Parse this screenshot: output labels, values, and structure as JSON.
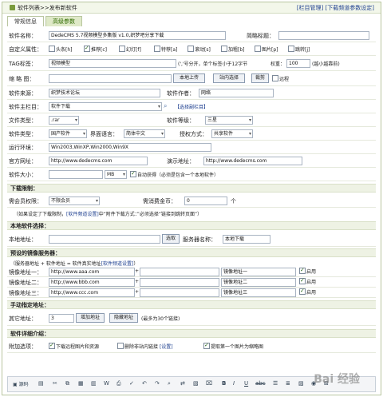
{
  "titlebar": {
    "crumb": "软件列表>>发布新软件",
    "link_manage": "[栏目管理]",
    "link_settings": "[下载频道参数设定]"
  },
  "tabs": [
    "常规信息",
    "高级参数"
  ],
  "form": {
    "software_name_label": "软件名称：",
    "software_name_value": "DedeCMS 5.7视频模型多集版 v1.0,织梦吧分享下载",
    "short_title_label": "简略标题：",
    "custom_attr_label": "自定义属性：",
    "attrs": [
      "头条[h]",
      "推荐[c]",
      "幻灯[f]",
      "特荐[a]",
      "滚动[s]",
      "加粗[b]",
      "图片[p]",
      "跳转[j]"
    ],
    "attrs_checked": [
      false,
      true,
      false,
      false,
      false,
      false,
      false,
      false
    ],
    "tag_label": "TAG标签：",
    "tag_value": "视频模型",
    "tag_hint": "(','号分开，单个标签小于12字节",
    "weight_label": "权重：",
    "weight_value": "100",
    "weight_hint": "(越小越靠前)",
    "thumb_label": "缩 略 图：",
    "upload_btn": "本地上传",
    "site_select_btn": "站内选择",
    "crop_btn": "裁剪",
    "remote_label": "远程",
    "source_label": "软件来源：",
    "source_value": "织梦技术论坛",
    "author_label": "软件作者：",
    "author_value": "网络",
    "column_label": "软件主栏目：",
    "column_value": "软件下载",
    "column_link": "【选择副栏目】",
    "filetype_label": "文件类型：",
    "filetype_value": ".rar",
    "level_label": "软件等级：",
    "level_value": "三星",
    "softtype_label": "软件类型：",
    "softtype_value": "国产软件",
    "lang_label": "界面语言：",
    "lang_value": "简体中文",
    "license_label": "授权方式：",
    "license_value": "共享软件",
    "env_label": "运行环境：",
    "env_value": "Win2003,WinXP,Win2000,Win9X",
    "website_label": "官方网址：",
    "website_value": "http://www.dedecms.com",
    "demo_label": "演示地址：",
    "demo_value": "http://www.dedecms.com",
    "size_label": "软件大小：",
    "size_unit": "MB",
    "auto_label": "自动获得（必须是包含一个本地软件）"
  },
  "download": {
    "section": "下载限制：",
    "need_member_label": "需会员权限：",
    "need_member_value": "不限会员",
    "need_coin_label": "需消费金币：",
    "need_coin_value": "0",
    "coin_unit": "个",
    "note_pre": "（如果设定了下载限制，",
    "note_link": "[软件频道设置]",
    "note_post": "中“附件下载方式：”必须选择“链接到跳转页面”）"
  },
  "local": {
    "section": "本地软件选择：",
    "addr_label": "本地地址：",
    "choose_btn": "选取",
    "server_label": "服务器名称：",
    "server_value": "本地下载"
  },
  "mirror": {
    "section": "预设的镜像服务器：",
    "formula": "（服务器地址 + 软件地址 = 软件真实地址",
    "formula_link": "[软件频道设置]",
    "formula_end": "）",
    "rows": [
      {
        "label": "镜像地址一：",
        "url": "http://www.aaa.com",
        "name": "镜像地址一",
        "enable": "启用"
      },
      {
        "label": "镜像地址二：",
        "url": "http://www.bbb.com",
        "name": "镜像地址二",
        "enable": "启用"
      },
      {
        "label": "镜像地址三：",
        "url": "http://www.ccc.com",
        "name": "镜像地址三",
        "enable": "启用"
      }
    ]
  },
  "manual": {
    "section": "手动指定地址：",
    "other_label": "其它地址：",
    "count_value": "3",
    "add_btn": "增加地址",
    "hide_btn": "隐藏地址",
    "hint": "(最多为30个链接)"
  },
  "intro": {
    "section": "软件详细介绍：",
    "options_label": "附加选项：",
    "opt1": "下载远程图片和资源",
    "opt2": "删除非站内链接",
    "opt2_link": "[设置]",
    "opt3": "提取第一个图片为缩略图",
    "source_btn": "源码"
  },
  "watermark": "Bai 经验"
}
